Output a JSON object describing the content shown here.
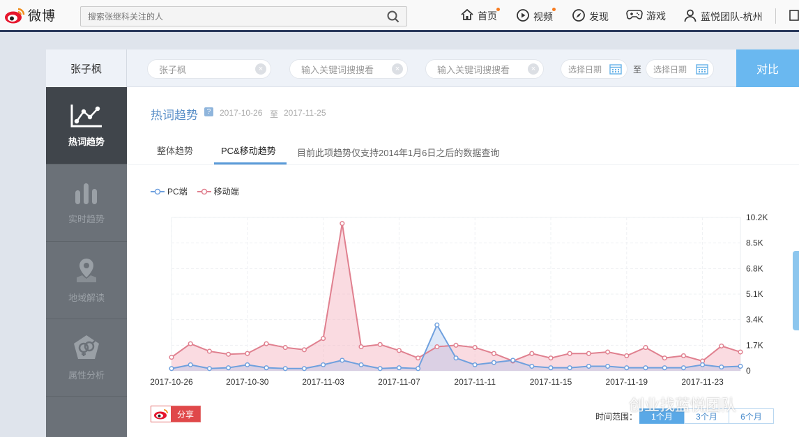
{
  "topbar": {
    "brand": "微博",
    "search_placeholder": "搜索张继科关注的人",
    "nav": [
      {
        "label": "首页",
        "icon": "home-icon"
      },
      {
        "label": "视频",
        "icon": "video-icon"
      },
      {
        "label": "发现",
        "icon": "compass-icon"
      },
      {
        "label": "游戏",
        "icon": "gamepad-icon"
      },
      {
        "label": "蓝悦团队-杭州",
        "icon": "user-icon"
      }
    ]
  },
  "compare": {
    "active_keyword": "张子枫",
    "keyword1": "张子枫",
    "keyword2_placeholder": "输入关键词搜搜看",
    "keyword3_placeholder": "输入关键词搜搜看",
    "date_start_placeholder": "选择日期",
    "date_sep": "至",
    "date_end_placeholder": "选择日期",
    "compare_label": "对比"
  },
  "sidebar": {
    "items": [
      {
        "label": "热词趋势",
        "icon": "trend-chart-icon",
        "active": true
      },
      {
        "label": "实时趋势",
        "icon": "bars-icon",
        "active": false
      },
      {
        "label": "地域解读",
        "icon": "map-pin-icon",
        "active": false
      },
      {
        "label": "属性分析",
        "icon": "gender-icon",
        "active": false
      }
    ]
  },
  "panel": {
    "title": "热词趋势",
    "help": "?",
    "range_start": "2017-10-26",
    "range_sep": "至",
    "range_end": "2017-11-25",
    "tabs": [
      "整体趋势",
      "PC&移动趋势"
    ],
    "active_tab": 1,
    "note": "目前此项趋势仅支持2014年1月6日之后的数据查询",
    "share_label": "分享",
    "time_range_label": "时间范围：",
    "time_range_options": [
      "1个月",
      "3个月",
      "6个月"
    ],
    "time_range_active": 0
  },
  "chart_data": {
    "type": "area",
    "x": [
      "2017-10-26",
      "2017-10-27",
      "2017-10-28",
      "2017-10-29",
      "2017-10-30",
      "2017-10-31",
      "2017-11-01",
      "2017-11-02",
      "2017-11-03",
      "2017-11-04",
      "2017-11-05",
      "2017-11-06",
      "2017-11-07",
      "2017-11-08",
      "2017-11-09",
      "2017-11-10",
      "2017-11-11",
      "2017-11-12",
      "2017-11-13",
      "2017-11-14",
      "2017-11-15",
      "2017-11-16",
      "2017-11-17",
      "2017-11-18",
      "2017-11-19",
      "2017-11-20",
      "2017-11-21",
      "2017-11-22",
      "2017-11-23",
      "2017-11-24",
      "2017-11-25"
    ],
    "x_tick_labels": [
      "2017-10-26",
      "2017-10-30",
      "2017-11-03",
      "2017-11-07",
      "2017-11-11",
      "2017-11-15",
      "2017-11-19",
      "2017-11-23"
    ],
    "y_ticks": [
      "0",
      "1.7K",
      "3.4K",
      "5.1K",
      "6.8K",
      "8.5K",
      "10.2K"
    ],
    "ylim": [
      0,
      10200
    ],
    "y_axis_side": "right",
    "legend_position": "top-left",
    "grid": true,
    "series": [
      {
        "name": "PC端",
        "color": "#6fa0de",
        "fill": "rgba(160,190,235,0.35)",
        "values": [
          150,
          400,
          150,
          200,
          400,
          200,
          150,
          150,
          400,
          700,
          400,
          150,
          200,
          150,
          3050,
          850,
          400,
          550,
          700,
          300,
          200,
          200,
          300,
          300,
          200,
          200,
          200,
          200,
          400,
          250,
          300
        ]
      },
      {
        "name": "移动端",
        "color": "#e0808f",
        "fill": "rgba(244,176,188,0.45)",
        "values": [
          900,
          1800,
          1300,
          1100,
          1150,
          1800,
          1550,
          1400,
          2150,
          9800,
          1600,
          1750,
          1350,
          850,
          1600,
          1700,
          1550,
          1150,
          650,
          1150,
          850,
          1150,
          1150,
          1250,
          1000,
          1550,
          850,
          1000,
          650,
          1650,
          1250
        ]
      }
    ]
  },
  "watermark": "创业找蓝悦团队"
}
